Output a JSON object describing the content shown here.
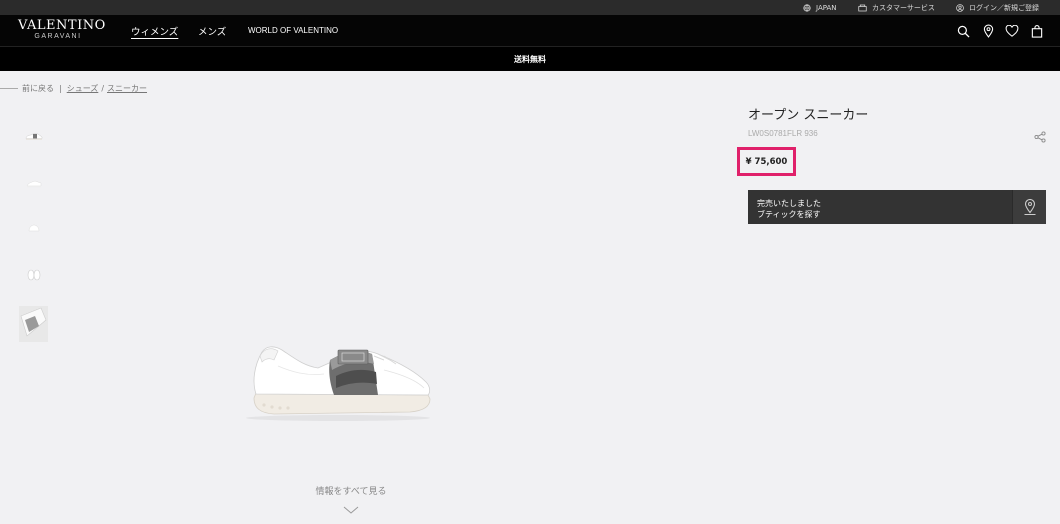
{
  "utility": {
    "region": "JAPAN",
    "customer_service": "カスタマーサービス",
    "login": "ログイン／新規ご登録"
  },
  "header": {
    "logo_main": "VALENTINO",
    "logo_sub": "GARAVANI",
    "nav": [
      "ウィメンズ",
      "メンズ",
      "WORLD OF VALENTINO"
    ],
    "active_nav": "ウィメンズ",
    "icons": [
      "search-icon",
      "location-pin-icon",
      "heart-icon",
      "shopping-bag-icon"
    ]
  },
  "promo": {
    "text": "送料無料"
  },
  "breadcrumb": {
    "back": "前に戻る",
    "items": [
      "シューズ",
      "スニーカー"
    ]
  },
  "product": {
    "title": "オープン スニーカー",
    "code": "LW0S0781FLR 936",
    "price": "¥ 75,600",
    "stock_line1": "完売いたしました",
    "stock_line2": "ブティックを探す",
    "thumbnail_count": 5
  },
  "gallery": {
    "see_all": "情報をすべて見る"
  },
  "colors": {
    "highlight": "#e0216a",
    "header_bg": "#050505",
    "utility_bg": "#2b2b2b",
    "page_bg": "#f1f1f3",
    "stock_bg": "#333333"
  }
}
